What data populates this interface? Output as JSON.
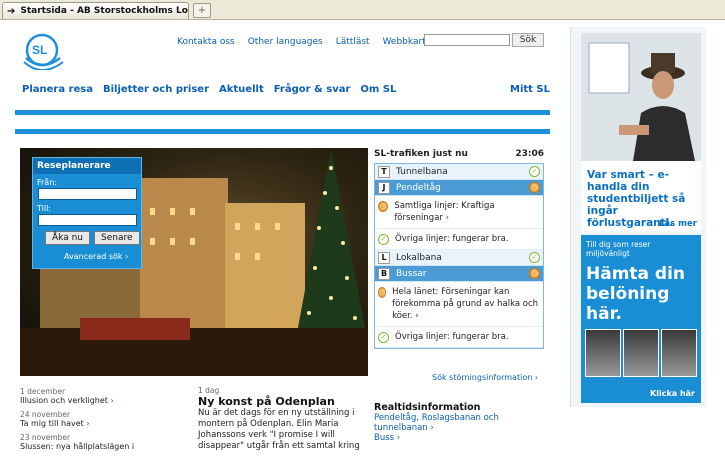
{
  "browser": {
    "tab_title": "Startsida - AB Storstockholms Lokal...",
    "new_tab": "+"
  },
  "header": {
    "logo_text": "SL",
    "links": [
      "Kontakta oss",
      "Other languages",
      "Lättläst",
      "Webbkarta"
    ],
    "search_placeholder": "",
    "search_button": "Sök"
  },
  "nav": {
    "items": [
      "Planera resa",
      "Biljetter och priser",
      "Aktuellt",
      "Frågor & svar",
      "Om SL"
    ],
    "mitt": "Mitt SL"
  },
  "planner": {
    "title": "Reseplanerare",
    "from_label": "Från:",
    "to_label": "Till:",
    "btn_now": "Åka nu",
    "btn_later": "Senare",
    "advanced": "Avancerad sök"
  },
  "news": [
    {
      "date": "1 december",
      "title": "Illusion och verklighet"
    },
    {
      "date": "24 november",
      "title": "Ta mig till havet"
    },
    {
      "date": "23 november",
      "title": "Slussen: nya hållplatslägen i"
    }
  ],
  "feature": {
    "date": "1 dag",
    "title": "Ny konst på Odenplan",
    "body": "Nu är det dags för en ny utställning i montern på Odenplan. Elin Maria Johanssons verk \"I promise I will disappear\" utgår från ett samtal kring"
  },
  "traffic": {
    "title": "SL-trafiken just nu",
    "time": "23:06",
    "rows": [
      {
        "code": "T",
        "name": "Tunnelbana",
        "status": "ok"
      },
      {
        "code": "J",
        "name": "Pendeltåg",
        "status": "warn",
        "highlight": true
      },
      {
        "code": "L",
        "name": "Lokalbana",
        "status": "ok"
      },
      {
        "code": "B",
        "name": "Bussar",
        "status": "warn",
        "highlight": true
      }
    ],
    "pendel_msgs": [
      {
        "status": "warn",
        "text": "Samtliga linjer: Kraftiga förseningar"
      },
      {
        "status": "ok",
        "text": "Övriga linjer: fungerar bra."
      }
    ],
    "buss_msgs": [
      {
        "status": "warn",
        "text": "Hela länet: Förseningar kan förekomma på grund av halka och köer."
      },
      {
        "status": "ok",
        "text": "Övriga linjer: fungerar bra."
      }
    ],
    "more": "Sök störningsinformation"
  },
  "realtime": {
    "title": "Realtidsinformation",
    "line1": "Pendeltåg, Roslagsbanan och tunnelbanan",
    "line2": "Buss"
  },
  "ads": {
    "ad1_text": "Var smart – e-handla din studentbiljett så ingår förlustgaranti.",
    "ad1_more": "Läs mer",
    "ad2_small": "Till dig som reser miljövänligt",
    "ad2_big": "Hämta din belöning här.",
    "ad2_click": "Klicka här"
  },
  "colors": {
    "accent": "#1e8fd9",
    "link": "#0a5fb4",
    "ok": "#7dbb2e",
    "warn": "#f1a53a"
  }
}
